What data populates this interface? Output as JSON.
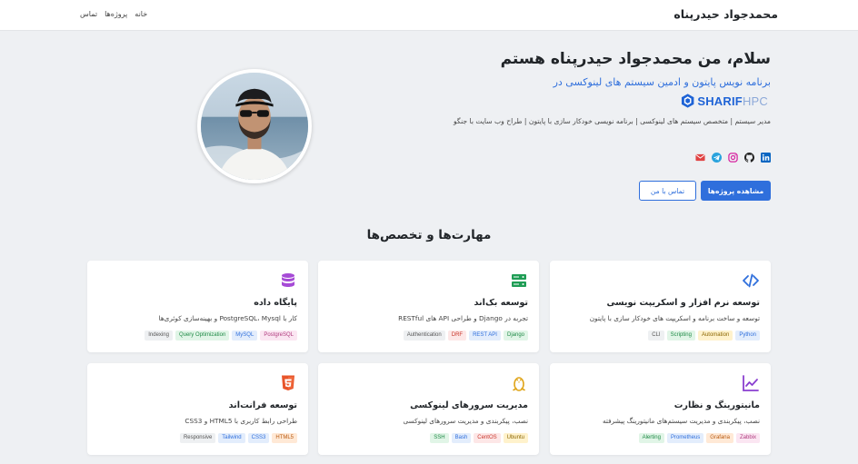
{
  "nav": {
    "brand": "محمدجواد حیدرپناه",
    "links": [
      "خانه",
      "پروژه‌ها",
      "تماس"
    ]
  },
  "hero": {
    "title": "سلام، من محمدجواد حیدرپناه هستم",
    "subtitle": "برنامه نویس پایتون و ادمین سیستم های لینوکسی در",
    "logo_text_bold": "SHARIF",
    "logo_text_light": "HPC",
    "description": "مدیر سیستم | متخصص سیستم های لینوکسی | برنامه نویسی خودکار سازی با پایتون | طراح وب سایت با جنگو",
    "socials": [
      "linkedin-icon",
      "github-icon",
      "instagram-icon",
      "telegram-icon",
      "email-icon"
    ],
    "primary_button": "مشاهده پروژه‌ها",
    "secondary_button": "تماس با من"
  },
  "skills": {
    "title": "مهارت‌ها و تخصص‌ها",
    "cards": [
      {
        "icon": "code-icon",
        "title": "توسعه نرم افزار و اسکریپت نویسی",
        "desc": "توسعه و ساخت برنامه و اسکریپت های خودکار سازی با پایتون",
        "tags": [
          {
            "label": "Python",
            "color": "blue"
          },
          {
            "label": "Automation",
            "color": "yellow"
          },
          {
            "label": "Scripting",
            "color": "green"
          },
          {
            "label": "CLI",
            "color": "gray"
          }
        ]
      },
      {
        "icon": "server-icon",
        "title": "توسعه بک‌اند",
        "desc": "تجربه در Django و طراحی API های RESTful",
        "tags": [
          {
            "label": "Django",
            "color": "green"
          },
          {
            "label": "REST API",
            "color": "blue"
          },
          {
            "label": "DRF",
            "color": "red"
          },
          {
            "label": "Authentication",
            "color": "gray"
          }
        ]
      },
      {
        "icon": "database-icon",
        "title": "پایگاه داده",
        "desc": "کار با PostgreSQL، Mysql و بهینه‌سازی کوئری‌ها",
        "tags": [
          {
            "label": "PostgreSQL",
            "color": "pink"
          },
          {
            "label": "MySQL",
            "color": "blue"
          },
          {
            "label": "Query Optimization",
            "color": "green"
          },
          {
            "label": "Indexing",
            "color": "gray"
          }
        ]
      },
      {
        "icon": "chart-line-icon",
        "title": "مانیتورینگ و نظارت",
        "desc": "نصب، پیکربندی و مدیریت سیستم‌های مانیتورینگ پیشرفته",
        "tags": [
          {
            "label": "Zabbix",
            "color": "pink"
          },
          {
            "label": "Grafana",
            "color": "orange"
          },
          {
            "label": "Prometheus",
            "color": "blue"
          },
          {
            "label": "Alerting",
            "color": "green"
          }
        ]
      },
      {
        "icon": "linux-icon",
        "title": "مدیریت سرورهای لینوکسی",
        "desc": "نصب، پیکربندی و مدیریت سرورهای لینوکسی",
        "tags": [
          {
            "label": "Ubuntu",
            "color": "yellow"
          },
          {
            "label": "CentOS",
            "color": "red"
          },
          {
            "label": "Bash",
            "color": "blue"
          },
          {
            "label": "SSH",
            "color": "green"
          }
        ]
      },
      {
        "icon": "html5-icon",
        "title": "توسعه فرانت‌اند",
        "desc": "طراحی رابط کاربری با HTML5 و CSS3",
        "tags": [
          {
            "label": "HTML5",
            "color": "orange"
          },
          {
            "label": "CSS3",
            "color": "blue"
          },
          {
            "label": "Tailwind",
            "color": "blue"
          },
          {
            "label": "Responsive",
            "color": "gray"
          }
        ]
      }
    ]
  }
}
